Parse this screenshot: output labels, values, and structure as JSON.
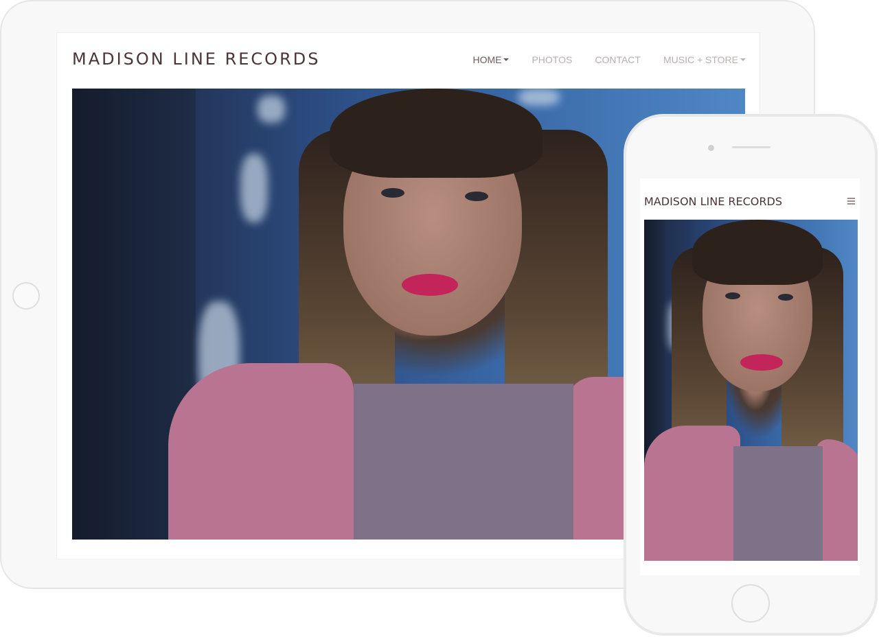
{
  "site": {
    "title": "MADISON LINE RECORDS"
  },
  "nav": {
    "items": [
      {
        "label": "HOME",
        "has_dropdown": true,
        "active": true
      },
      {
        "label": "PHOTOS",
        "has_dropdown": false,
        "active": false
      },
      {
        "label": "CONTACT",
        "has_dropdown": false,
        "active": false
      },
      {
        "label": "MUSIC + STORE",
        "has_dropdown": true,
        "active": false
      }
    ]
  },
  "mobile": {
    "title": "MADISON LINE RECORDS",
    "menu_icon": "hamburger-icon"
  },
  "colors": {
    "logo": "#4a3537",
    "nav_active": "#6b5a5c",
    "nav_inactive": "#b8b0b1",
    "device_frame": "#f8f8f8"
  }
}
